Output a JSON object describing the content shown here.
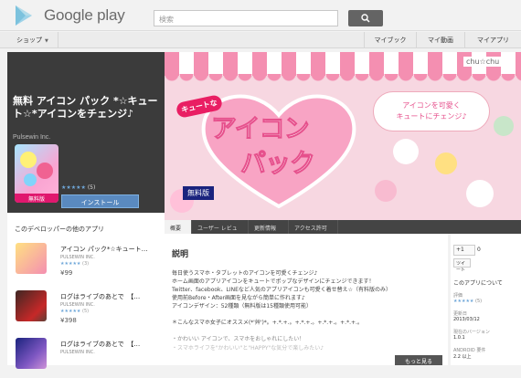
{
  "header": {
    "brand": "Google play",
    "search_placeholder": "検索",
    "search_button": "search-icon"
  },
  "nav": {
    "shop": "ショップ",
    "items": [
      "マイブック",
      "マイ動画",
      "マイアプリ"
    ]
  },
  "app": {
    "title": "無料 アイコン パック *☆キュート☆*アイコンをチェンジ♪",
    "developer": "Pulsewin Inc.",
    "rating_stars": "★★★★★",
    "rating_count": "(5)",
    "icon_badge": "無料版",
    "install_label": "インストール"
  },
  "banner": {
    "brand": "chu☆chu",
    "tag": "キュートな",
    "title1": "アイコン",
    "title2": "パック",
    "badge": "無料版",
    "bubble_line1": "アイコンを可愛く",
    "bubble_line2": "キュートにチェンジ♪"
  },
  "sidebar": {
    "heading": "このデベロッパーの他のアプリ",
    "apps": [
      {
        "name": "アイコン パック*☆キュート…",
        "developer": "PULSEWIN INC.",
        "stars": "★★★★★",
        "count": "(3)",
        "price": "¥99"
      },
      {
        "name": "ログはライブのあとで　【…",
        "developer": "PULSEWIN INC.",
        "stars": "★★★★★",
        "count": "(5)",
        "price": "¥398"
      },
      {
        "name": "ログはライブのあとで　【…",
        "developer": "PULSEWIN INC.",
        "stars": "",
        "count": "",
        "price": ""
      }
    ]
  },
  "tabs": [
    "概要",
    "ユーザー レビュー",
    "更新情報",
    "アクセス許可"
  ],
  "description": {
    "heading": "説明",
    "lines": [
      "毎日使うスマホ・タブレットのアイコンを可愛くチェンジ♪",
      "ホーム画面のアプリアイコンをキュートでポップなデザインにチェンジできます！",
      "Twitter、facebook、LINEなど人気のアプリアイコンも可愛く着せ替え☆（有料版のみ）",
      "使用前Before・After画面を見ながら簡単に作れます♪",
      "アイコンデザイン：52種類（無料版は15種類使用可能）",
      "",
      "＊こんなスマホ女子にオススメ(*'艸')*。+.*.+.。+.*.+.。+.*.+.。+.*.+.。",
      "",
      "・かわいい アイコンで、スマホをおしゃれにしたい！",
      "・スマホライフを\"かわいい\"と\"HAPPY\"な気分で楽しみたい♪"
    ],
    "more_label": "もっと見る"
  },
  "right": {
    "gplus": "+1",
    "gplus_count": "0",
    "tweet": "ツイート",
    "about": "このアプリについて",
    "rating_label": "評価",
    "rating_stars": "★★★★★",
    "rating_count": "(5)",
    "updated_label": "更新日",
    "updated": "2013/03/12",
    "version_label": "現在のバージョン",
    "version": "1.0.1",
    "android_label": "ANDROID 要件",
    "android": "2.2 以上"
  },
  "colors": {
    "accent_blue": "#5a8ac0",
    "pink": "#e91e63",
    "dark": "#3b3b3b"
  }
}
